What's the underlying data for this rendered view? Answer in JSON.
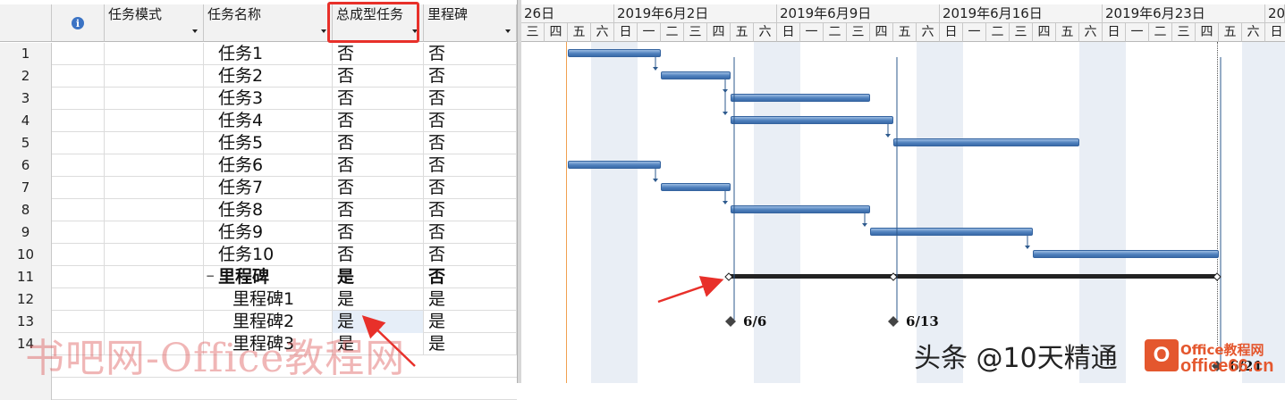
{
  "columns": {
    "info_icon": "i",
    "mode": "任务模式",
    "name": "任务名称",
    "summary": "总成型任务",
    "milestone": "里程碑"
  },
  "rows": [
    {
      "id": "1",
      "name": "任务1",
      "summary": "否",
      "milestone": "否"
    },
    {
      "id": "2",
      "name": "任务2",
      "summary": "否",
      "milestone": "否"
    },
    {
      "id": "3",
      "name": "任务3",
      "summary": "否",
      "milestone": "否"
    },
    {
      "id": "4",
      "name": "任务4",
      "summary": "否",
      "milestone": "否"
    },
    {
      "id": "5",
      "name": "任务5",
      "summary": "否",
      "milestone": "否"
    },
    {
      "id": "6",
      "name": "任务6",
      "summary": "否",
      "milestone": "否"
    },
    {
      "id": "7",
      "name": "任务7",
      "summary": "否",
      "milestone": "否"
    },
    {
      "id": "8",
      "name": "任务8",
      "summary": "否",
      "milestone": "否"
    },
    {
      "id": "9",
      "name": "任务9",
      "summary": "否",
      "milestone": "否"
    },
    {
      "id": "10",
      "name": "任务10",
      "summary": "否",
      "milestone": "否"
    },
    {
      "id": "11",
      "name": "里程碑",
      "summary": "是",
      "milestone": "否",
      "collapse": "−"
    },
    {
      "id": "12",
      "name": "里程碑1",
      "summary": "是",
      "milestone": "是"
    },
    {
      "id": "13",
      "name": "里程碑2",
      "summary": "是",
      "milestone": "是"
    },
    {
      "id": "14",
      "name": "里程碑3",
      "summary": "是",
      "milestone": "是"
    }
  ],
  "timeline": {
    "weeks": [
      "26日",
      "2019年6月2日",
      "2019年6月9日",
      "2019年6月16日",
      "2019年6月23日",
      "20"
    ],
    "days": [
      "三",
      "四",
      "五",
      "六",
      "日",
      "一",
      "二",
      "三",
      "四",
      "五",
      "六",
      "日",
      "一",
      "二",
      "三",
      "四",
      "五",
      "六",
      "日",
      "一",
      "二",
      "三",
      "四",
      "五",
      "六",
      "日",
      "一",
      "二",
      "三",
      "四",
      "五",
      "六",
      "日"
    ],
    "milestone_labels": [
      "6/6",
      "6/13",
      "6/21"
    ]
  },
  "colors": {
    "highlight_box": "#e8302a",
    "arrow": "#e8302a",
    "bar_blue": "#4f81bd",
    "today_line": "#f0a050"
  },
  "watermark": {
    "text": "书吧网-Office教程网",
    "credit": "头条 @10天精通",
    "logo_letter": "O",
    "logo_line1": "Office教程网",
    "logo_line2": "office66.cn"
  }
}
